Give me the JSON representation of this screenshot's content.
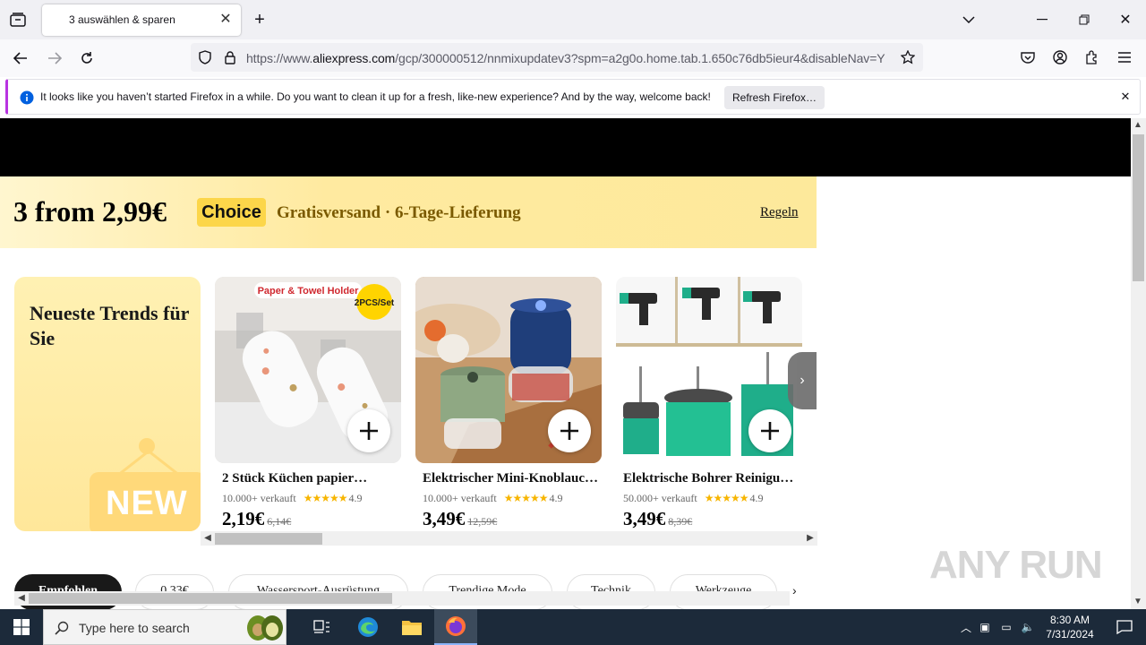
{
  "browser": {
    "tab_title": "3 auswählen & sparen",
    "url_prefix": "https://www.",
    "url_domain": "aliexpress.com",
    "url_rest": "/gcp/300000512/nnmixupdatev3?spm=a2g0o.home.tab.1.650c76db5ieur4&disableNav=Y",
    "notification_text": "It looks like you haven’t started Firefox in a while. Do you want to clean it up for a fresh, like-new experience? And by the way, welcome back!",
    "refresh_button": "Refresh Firefox…"
  },
  "banner": {
    "title": "3 from 2,99€",
    "badge": "Choice",
    "subtitle": "Gratisversand · 6-Tage-Lieferung",
    "rules_link": "Regeln"
  },
  "trend_card": {
    "title": "Neueste Trends für Sie",
    "new_label": "NEW"
  },
  "products": [
    {
      "title": "2 Stück Küchen papier…",
      "sold": "10.000+ verkauft",
      "stars": "★★★★★",
      "rating": "4.9",
      "price": "2,19€",
      "old_price": "6,14€",
      "image_label": "Paper & Towel Holder",
      "image_badge": "2PCS/Set"
    },
    {
      "title": "Elektrischer Mini-Knoblauch…",
      "sold": "10.000+ verkauft",
      "stars": "★★★★★",
      "rating": "4.9",
      "price": "3,49€",
      "old_price": "12,59€"
    },
    {
      "title": "Elektrische Bohrer Reinigun…",
      "sold": "50.000+ verkauft",
      "stars": "★★★★★",
      "rating": "4.9",
      "price": "3,49€",
      "old_price": "8,39€"
    }
  ],
  "chips": [
    {
      "label": "Empfohlen",
      "active": true
    },
    {
      "label": "0,33€"
    },
    {
      "label": "Wassersport-Ausrüstung"
    },
    {
      "label": "Trendige Mode"
    },
    {
      "label": "Technik"
    },
    {
      "label": "Werkzeuge"
    }
  ],
  "watermark": "ANY RUN",
  "taskbar": {
    "search_placeholder": "Type here to search",
    "time": "8:30 AM",
    "date": "7/31/2024"
  },
  "colors": {
    "accent_purple": "#b833e1",
    "choice_yellow": "#fcd64a",
    "banner_text": "#7a5a00",
    "star": "#f7b500"
  }
}
